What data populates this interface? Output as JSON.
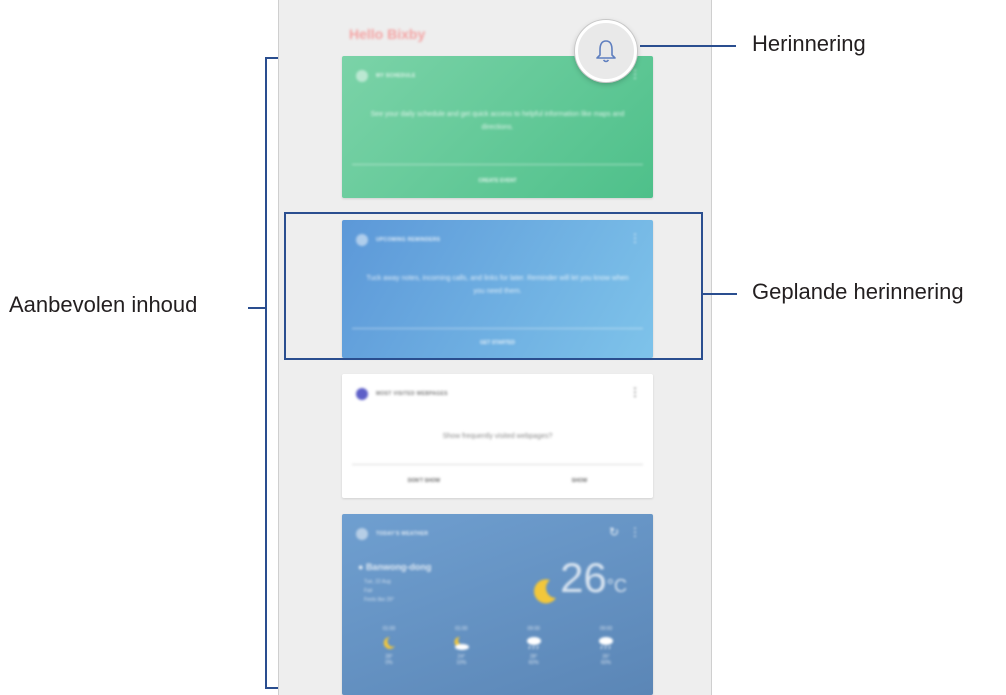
{
  "annotations": {
    "herinnering": "Herinnering",
    "geplande_herinnering": "Geplande herinnering",
    "aanbevolen_inhoud": "Aanbevolen inhoud"
  },
  "header": {
    "greeting": "Hello Bixby"
  },
  "cards": {
    "schedule": {
      "title": "MY SCHEDULE",
      "body": "See your daily schedule and get quick access to helpful information like maps and directions.",
      "action": "CREATE EVENT",
      "icon": "calendar-icon"
    },
    "reminder": {
      "title": "UPCOMING REMINDERS",
      "body": "Tuck away notes, incoming calls, and links for later. Reminder will let you know when you need them.",
      "action": "GET STARTED",
      "icon": "bell-icon"
    },
    "webpages": {
      "title": "MOST VISITED WEBPAGES",
      "body": "Show frequently visited webpages?",
      "action_left": "DON'T SHOW",
      "action_right": "SHOW",
      "icon": "internet-icon"
    },
    "weather": {
      "title": "TODAY'S WEATHER",
      "location": "Banwong-dong",
      "date": "Tue, 22 Aug",
      "condition": "Fair",
      "feels": "Feels like 29°",
      "temperature": "26",
      "unit": "°C",
      "forecast": [
        {
          "time": "01:00",
          "temp": "28°",
          "rain": "0%",
          "icon": "moon-icon"
        },
        {
          "time": "01:00",
          "temp": "24°",
          "rain": "10%",
          "icon": "cloudy-moon-icon"
        },
        {
          "time": "09:00",
          "temp": "28°",
          "rain": "60%",
          "icon": "rain-icon"
        },
        {
          "time": "09:00",
          "temp": "26°",
          "rain": "60%",
          "icon": "rain-icon"
        }
      ]
    }
  },
  "colors": {
    "accent_line": "#2a4e8f",
    "schedule_card": "#5cc795",
    "reminder_card": "#6aaae0",
    "weather_card": "#6591c3"
  }
}
